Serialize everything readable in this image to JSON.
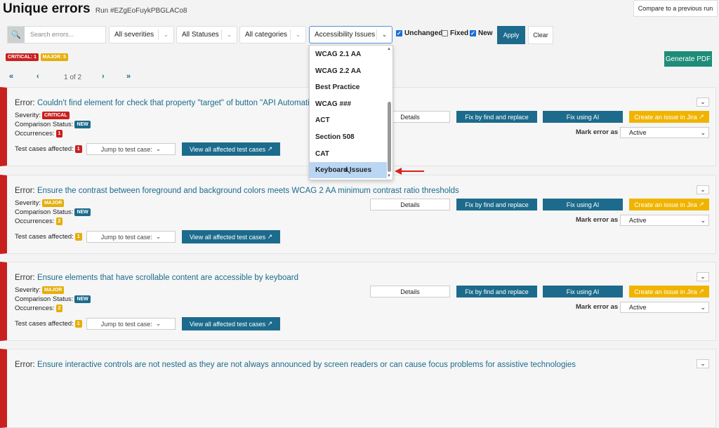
{
  "header": {
    "title": "Unique errors",
    "run": "Run #EZgEoFuykPBGLACo8",
    "compare": "Compare to a previous run"
  },
  "filters": {
    "search_placeholder": "Search errors...",
    "severity": "All severities",
    "status": "All Statuses",
    "category": "All categories",
    "type": "Accessibility Issues",
    "unchanged": "Unchanged",
    "fixed": "Fixed",
    "new": "New",
    "unchanged_checked": true,
    "fixed_checked": false,
    "new_checked": true,
    "apply": "Apply",
    "clear": "Clear"
  },
  "summary": {
    "critical": "CRITICAL: 1",
    "major": "MAJOR: 5"
  },
  "generate_pdf": "Generate PDF",
  "pager": {
    "first": "«",
    "prev": "‹",
    "page": "1 of 2",
    "next": "›",
    "last": "»"
  },
  "dropdown": {
    "options": [
      "WCAG 2.1 AA",
      "WCAG 2.2 AA",
      "Best Practice",
      "WCAG ###",
      "ACT",
      "Section 508",
      "CAT",
      "Keyboard Issues"
    ],
    "highlighted": "Keyboard Issues"
  },
  "labels": {
    "error": "Error:",
    "severity": "Severity:",
    "comparison": "Comparison Status:",
    "occurrences": "Occurrences:",
    "test_cases": "Test cases affected:",
    "jump": "Jump to test case:",
    "view_all": "View all affected test cases",
    "details": "Details",
    "fix_replace": "Fix by find and replace",
    "fix_ai": "Fix using AI",
    "jira": "Create an issue in Jira",
    "mark": "Mark error as",
    "mark_value": "Active"
  },
  "errors": [
    {
      "message": "Couldn't find element for check that property \"target\" of button \"API Automation\" is equal to \"_blank\"",
      "severity": "CRITICAL",
      "status": "NEW",
      "occurrences": "1",
      "test_cases": "1"
    },
    {
      "message": "Ensure the contrast between foreground and background colors meets WCAG 2 AA minimum contrast ratio thresholds",
      "severity": "MAJOR",
      "status": "NEW",
      "occurrences": "2",
      "test_cases": "1"
    },
    {
      "message": "Ensure elements that have scrollable content are accessible by keyboard",
      "severity": "MAJOR",
      "status": "NEW",
      "occurrences": "2",
      "test_cases": "1"
    },
    {
      "message": "Ensure interactive controls are not nested as they are not always announced by screen readers or can cause focus problems for assistive technologies"
    }
  ]
}
